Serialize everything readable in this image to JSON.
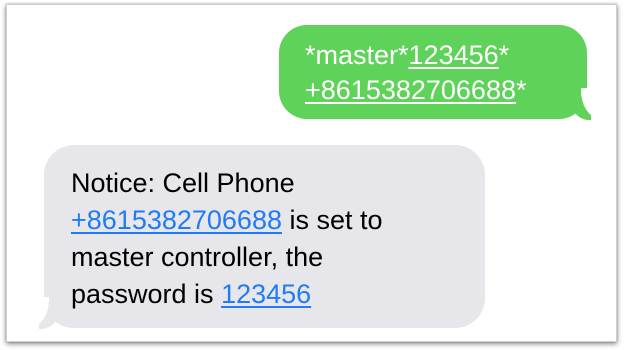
{
  "conversation": {
    "outgoing": {
      "prefix": "*master*",
      "password": "123456",
      "star_after_password": "*",
      "phone": "+8615382706688",
      "star_after_phone": "*"
    },
    "incoming": {
      "line1": "Notice: Cell Phone",
      "phone": "+8615382706688",
      "after_phone": " is set to",
      "line3": "master controller, the",
      "password_prefix": "password is ",
      "password": "123456"
    }
  },
  "colors": {
    "outgoing_bubble": "#5fd25a",
    "incoming_bubble": "#e6e6eb",
    "link": "#1f7cf5"
  }
}
